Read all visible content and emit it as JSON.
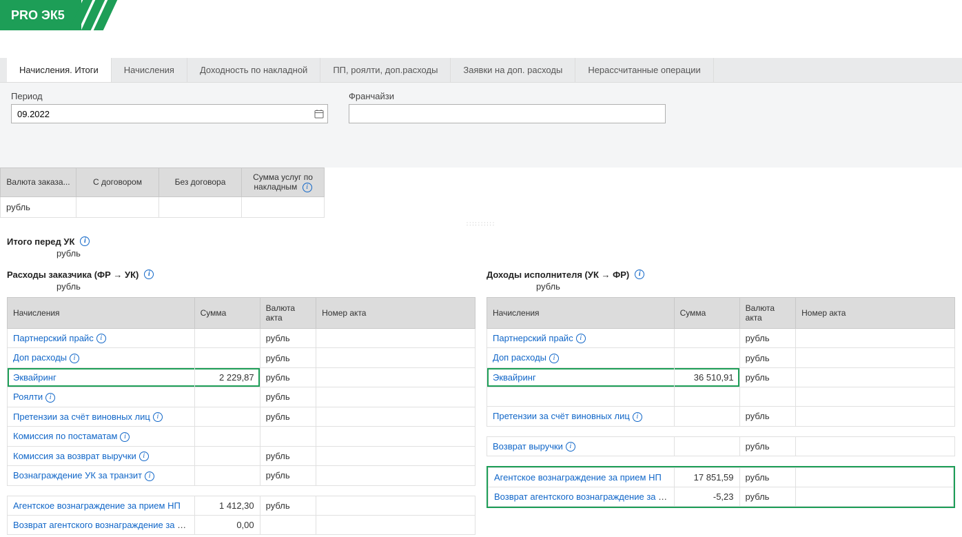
{
  "header": {
    "logo": "PRO ЭК5"
  },
  "tabs": [
    "Начисления. Итоги",
    "Начисления",
    "Доходность по накладной",
    "ПП, роялти, доп.расходы",
    "Заявки на доп. расходы",
    "Нерассчитанные операции"
  ],
  "active_tab": 0,
  "filters": {
    "period_label": "Период",
    "period_value": "09.2022",
    "franch_label": "Франчайзи",
    "franch_value": ""
  },
  "summary": {
    "headers": {
      "currency": "Валюта заказа...",
      "with_contract": "С договором",
      "no_contract": "Без договора",
      "services": "Сумма услуг по накладным"
    },
    "row": {
      "currency": "рубль",
      "with_contract": "",
      "no_contract": "",
      "services": ""
    }
  },
  "totals": {
    "title": "Итого перед УК",
    "currency": "рубль"
  },
  "left": {
    "title": "Расходы заказчика (ФР → УК)",
    "currency": "рубль",
    "headers": {
      "name": "Начисления",
      "sum": "Сумма",
      "act_cur": "Валюта акта",
      "act_num": "Номер акта"
    },
    "rows": [
      {
        "name": "Партнерский прайс",
        "sum": "",
        "cur": "рубль",
        "info": true
      },
      {
        "name": "Доп расходы",
        "sum": "",
        "cur": "рубль",
        "info": true
      },
      {
        "name": "Эквайринг",
        "sum": "2 229,87",
        "cur": "рубль",
        "hl": true,
        "info": false
      },
      {
        "name": "Роялти",
        "sum": "",
        "cur": "рубль",
        "info": true
      },
      {
        "name": "Претензии за счёт виновных лиц",
        "sum": "",
        "cur": "рубль",
        "info": true
      },
      {
        "name": "Комиссия по постаматам",
        "sum": "",
        "cur": "",
        "info": true
      },
      {
        "name": "Комиссия за возврат выручки",
        "sum": "",
        "cur": "рубль",
        "info": true
      },
      {
        "name": "Вознаграждение УК за транзит",
        "sum": "",
        "cur": "рубль",
        "info": true
      }
    ],
    "agent_rows": [
      {
        "name": "Агентское вознаграждение за прием НП",
        "sum": "1 412,30",
        "cur": "рубль"
      },
      {
        "name": "Возврат агентского вознаграждение за п...",
        "sum": "0,00",
        "cur": ""
      }
    ]
  },
  "right": {
    "title": "Доходы исполнителя (УК → ФР)",
    "currency": "рубль",
    "headers": {
      "name": "Начисления",
      "sum": "Сумма",
      "act_cur": "Валюта акта",
      "act_num": "Номер акта"
    },
    "rows": [
      {
        "name": "Партнерский прайс",
        "sum": "",
        "cur": "рубль",
        "info": true
      },
      {
        "name": "Доп расходы",
        "sum": "",
        "cur": "рубль",
        "info": true
      },
      {
        "name": "Эквайринг",
        "sum": "36 510,91",
        "cur": "рубль",
        "hl": true,
        "info": false
      },
      {
        "name": "",
        "sum": "",
        "cur": "",
        "blank": true
      },
      {
        "name": "Претензии за счёт виновных лиц",
        "sum": "",
        "cur": "рубль",
        "info": true
      }
    ],
    "return_rows": [
      {
        "name": "Возврат выручки",
        "sum": "",
        "cur": "рубль",
        "info": true
      }
    ],
    "agent_rows": [
      {
        "name": "Агентское вознаграждение за прием НП",
        "sum": "17 851,59",
        "cur": "рубль"
      },
      {
        "name": "Возврат агентского вознаграждение за п...",
        "sum": "-5,23",
        "cur": "рубль"
      }
    ]
  }
}
